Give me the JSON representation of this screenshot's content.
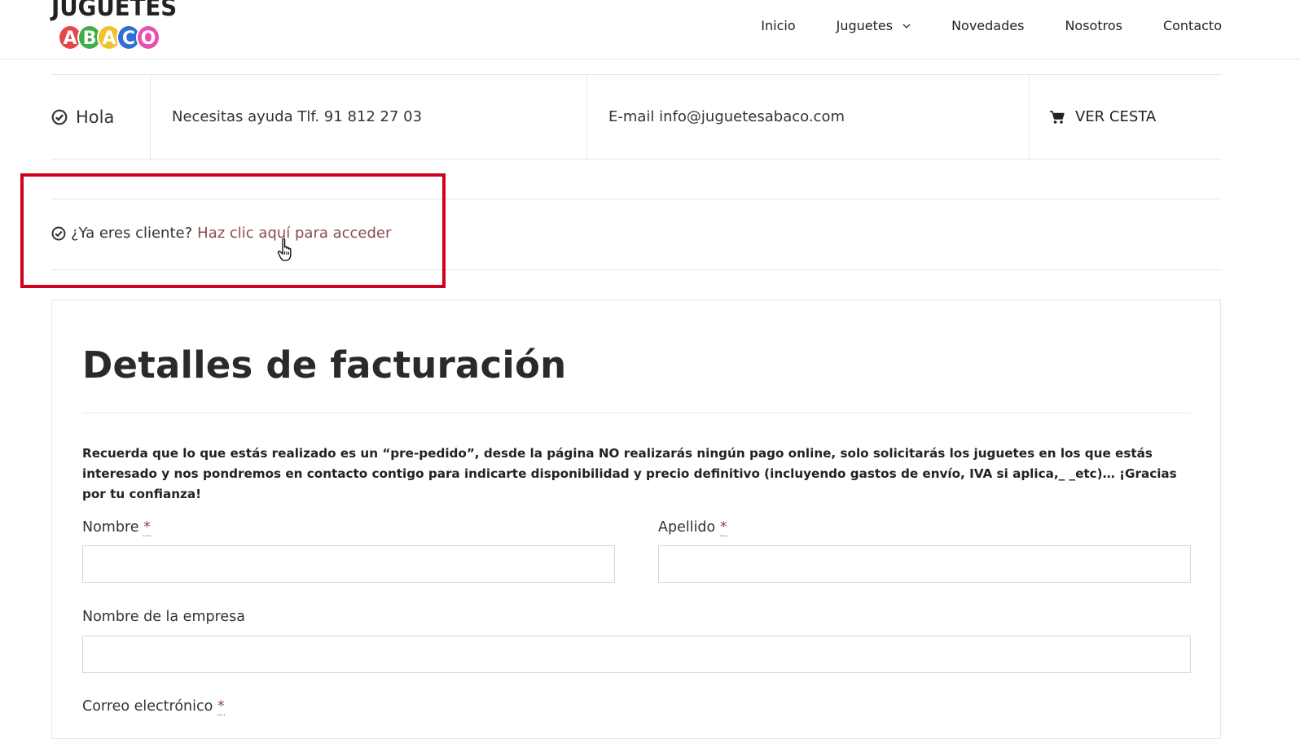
{
  "header": {
    "logo": {
      "word": "JUGUETES",
      "letters": [
        "A",
        "B",
        "A",
        "C",
        "O"
      ],
      "letter_colors": [
        "#e64646",
        "#3fae49",
        "#f2c12e",
        "#2f6fd6",
        "#e94fb0"
      ]
    },
    "nav": [
      {
        "label": "Inicio"
      },
      {
        "label": "Juguetes",
        "has_dropdown": true
      },
      {
        "label": "Novedades"
      },
      {
        "label": "Nosotros"
      },
      {
        "label": "Contacto"
      }
    ]
  },
  "infobar": {
    "greeting": "Hola",
    "help": "Necesitas ayuda Tlf. 91 812 27 03",
    "email": "E-mail info@juguetesabaco.com",
    "cart": "VER CESTA"
  },
  "login_notice": {
    "question": "¿Ya eres cliente?",
    "link": "Haz clic aquí para acceder"
  },
  "billing": {
    "title": "Detalles de facturación",
    "note": "Recuerda que lo que estás realizado es un “pre-pedido”, desde la página NO realizarás ningún pago online, solo solicitarás los juguetes en los que estás interesado y nos pondremos en contacto contigo para indicarte disponibilidad y precio definitivo (incluyendo gastos de envío, IVA si aplica,_ _etc)… ¡Gracias por tu confianza!",
    "fields": {
      "first_name": {
        "label": "Nombre",
        "required": "*",
        "value": ""
      },
      "last_name": {
        "label": "Apellido",
        "required": "*",
        "value": ""
      },
      "company": {
        "label": "Nombre de la empresa",
        "value": ""
      },
      "email": {
        "label": "Correo electrónico",
        "required": "*"
      }
    }
  },
  "colors": {
    "highlight": "#d0021b",
    "link": "#8a4b4b"
  }
}
